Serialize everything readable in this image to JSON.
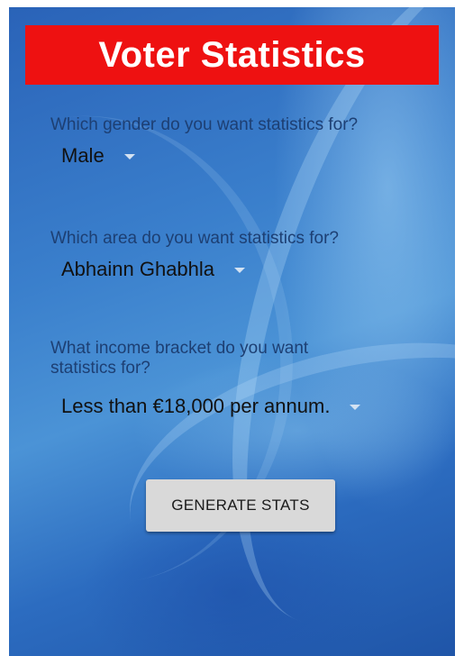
{
  "app": {
    "title": "Voter Statistics"
  },
  "gender": {
    "question": "Which gender do you want statistics for?",
    "selected": "Male"
  },
  "area": {
    "question": "Which area do you want statistics for?",
    "selected": "Abhainn Ghabhla"
  },
  "income": {
    "question": "What income bracket do you want statistics for?",
    "selected": "Less than €18,000 per annum."
  },
  "actions": {
    "generate_label": "GENERATE STATS"
  },
  "colors": {
    "title_background": "#ee1111",
    "title_text": "#ffffff",
    "question_text": "#1d3f73",
    "button_background": "#d9d9d9"
  },
  "icons": {
    "dropdown": "triangle-down-icon"
  }
}
